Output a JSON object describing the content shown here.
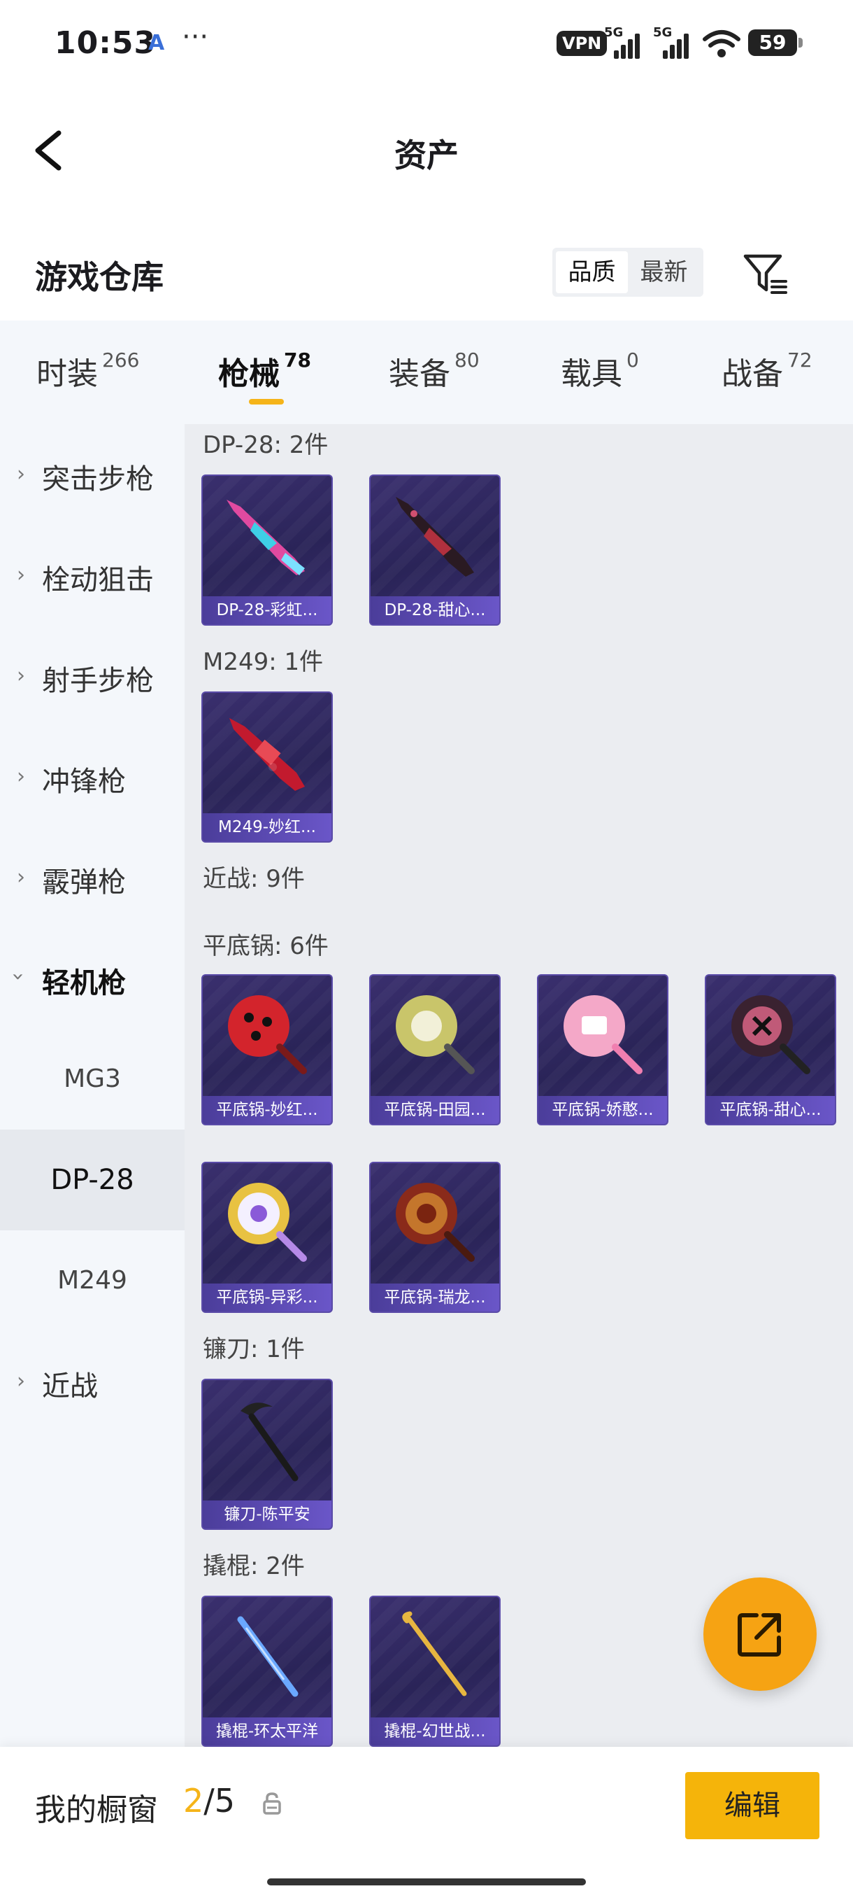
{
  "status_bar": {
    "time": "10:53",
    "app_glyph": "A",
    "more": "···",
    "vpn": "VPN",
    "signal_tag": "5G",
    "battery": "59"
  },
  "header": {
    "title": "资产"
  },
  "warehouse": {
    "title": "游戏仓库",
    "sort_options": [
      "品质",
      "最新"
    ]
  },
  "tabs": [
    {
      "label": "时装",
      "count": "266"
    },
    {
      "label": "枪械",
      "count": "78"
    },
    {
      "label": "装备",
      "count": "80"
    },
    {
      "label": "载具",
      "count": "0"
    },
    {
      "label": "战备",
      "count": "72"
    }
  ],
  "sidebar": {
    "items": [
      {
        "label": "突击步枪"
      },
      {
        "label": "栓动狙击"
      },
      {
        "label": "射手步枪"
      },
      {
        "label": "冲锋枪"
      },
      {
        "label": "霰弹枪"
      },
      {
        "label": "轻机枪"
      },
      {
        "label": "近战"
      }
    ],
    "subitems": [
      "MG3",
      "DP-28",
      "M249"
    ]
  },
  "sections": [
    {
      "title": "DP-28: 2件",
      "items": [
        "DP-28-彩虹...",
        "DP-28-甜心..."
      ]
    },
    {
      "title": "M249: 1件",
      "items": [
        "M249-妙红..."
      ]
    },
    {
      "title": "近战: 9件"
    },
    {
      "title": "平底锅: 6件",
      "items": [
        "平底锅-妙红...",
        "平底锅-田园...",
        "平底锅-娇憨...",
        "平底锅-甜心...",
        "平底锅-异彩...",
        "平底锅-瑞龙..."
      ]
    },
    {
      "title": "镰刀: 1件",
      "items": [
        "镰刀-陈平安"
      ]
    },
    {
      "title": "撬棍: 2件",
      "items": [
        "撬棍-环太平洋",
        "撬棍-幻世战..."
      ]
    }
  ],
  "bottom": {
    "label": "我的橱窗",
    "current": "2",
    "total": "/5",
    "edit": "编辑"
  },
  "icons": {
    "back": "chevron-left-icon",
    "filter": "filter-icon",
    "share": "share-out-icon",
    "lock": "lock-icon"
  },
  "colors": {
    "accent": "#f5b419",
    "card_bg": "#2a2458",
    "card_label": "#6a56c8"
  }
}
